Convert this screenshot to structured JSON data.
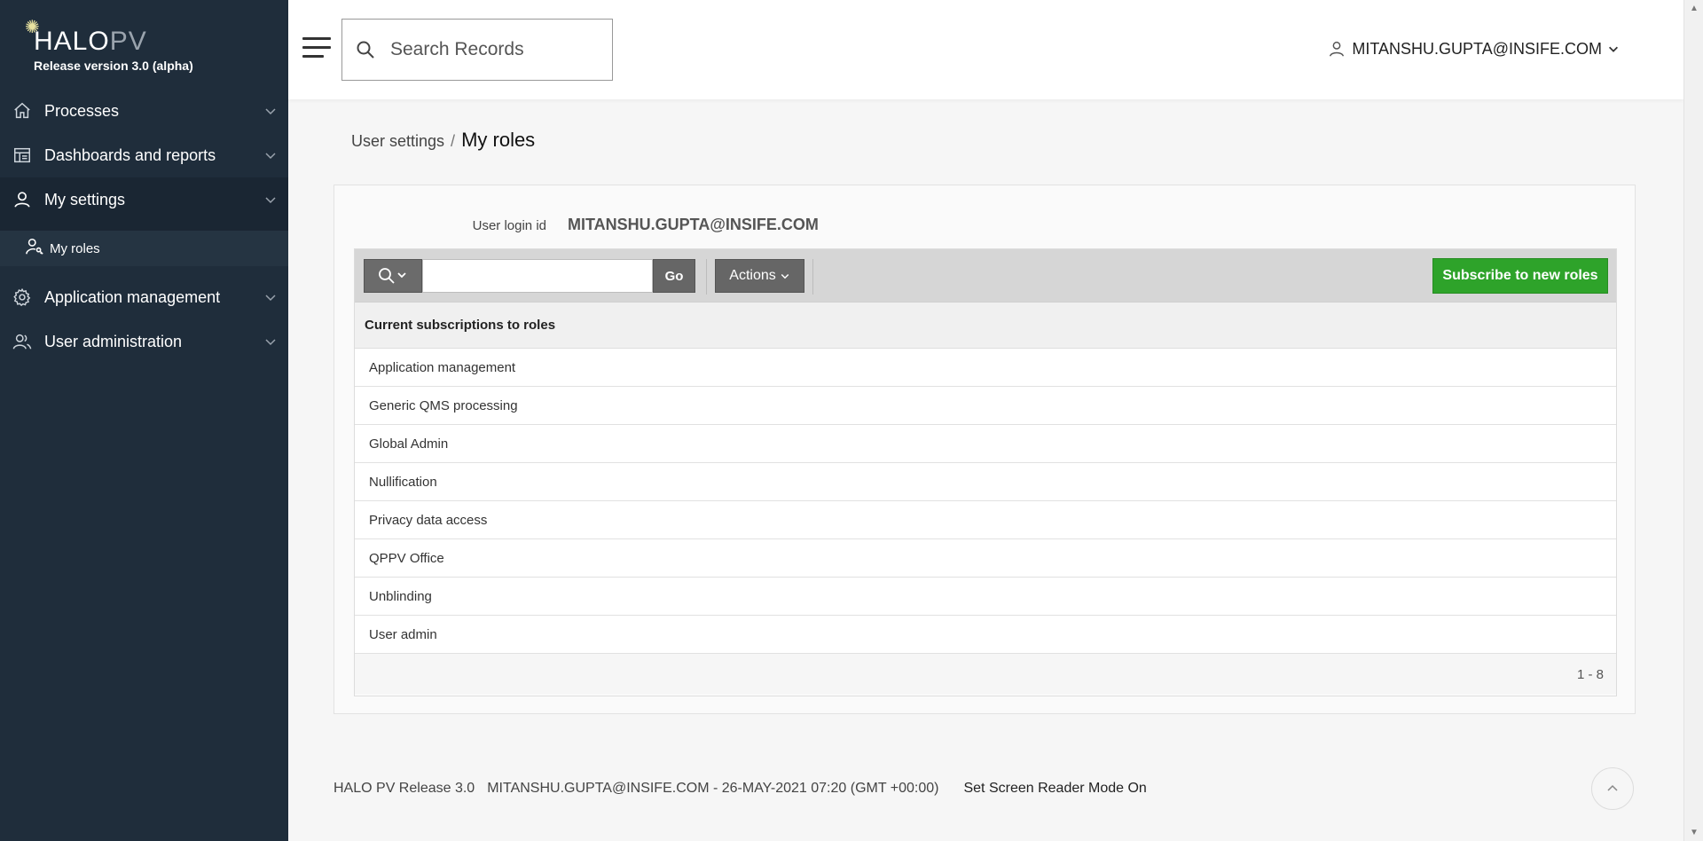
{
  "brand": {
    "logo_halo": "HALO",
    "logo_pv": "PV",
    "release": "Release version 3.0 (alpha)"
  },
  "sidebar": {
    "items": [
      {
        "label": "Processes",
        "icon": "home-icon"
      },
      {
        "label": "Dashboards and reports",
        "icon": "dashboard-icon"
      },
      {
        "label": "My settings",
        "icon": "user-icon",
        "expanded": true
      },
      {
        "label": "Application management",
        "icon": "gear-icon"
      },
      {
        "label": "User administration",
        "icon": "users-icon"
      }
    ],
    "sub_items": [
      {
        "label": "My roles",
        "icon": "user-key-icon",
        "parent": "My settings"
      }
    ]
  },
  "header": {
    "search_placeholder": "Search Records",
    "user": "MITANSHU.GUPTA@INSIFE.COM"
  },
  "breadcrumb": {
    "parent": "User settings",
    "separator": "/",
    "current": "My roles"
  },
  "card": {
    "login_label": "User login id",
    "login_value": "MITANSHU.GUPTA@INSIFE.COM"
  },
  "toolbar": {
    "search_value": "",
    "go_label": "Go",
    "actions_label": "Actions",
    "subscribe_label": "Subscribe to new roles"
  },
  "table": {
    "header": "Current subscriptions to roles",
    "rows": [
      "Application management",
      "Generic QMS processing",
      "Global Admin",
      "Nullification",
      "Privacy data access",
      "QPPV Office",
      "Unblinding",
      "User admin"
    ],
    "pagination": "1 - 8"
  },
  "footer": {
    "release": "HALO PV Release 3.0",
    "session": "MITANSHU.GUPTA@INSIFE.COM - 26-MAY-2021 07:20 (GMT +00:00)",
    "screen_reader": "Set Screen Reader Mode On"
  },
  "colors": {
    "sidebar_bg": "#1f2d3b",
    "subscribe_button": "#2ea32a",
    "toolbar_bg": "#d6d6d6"
  }
}
